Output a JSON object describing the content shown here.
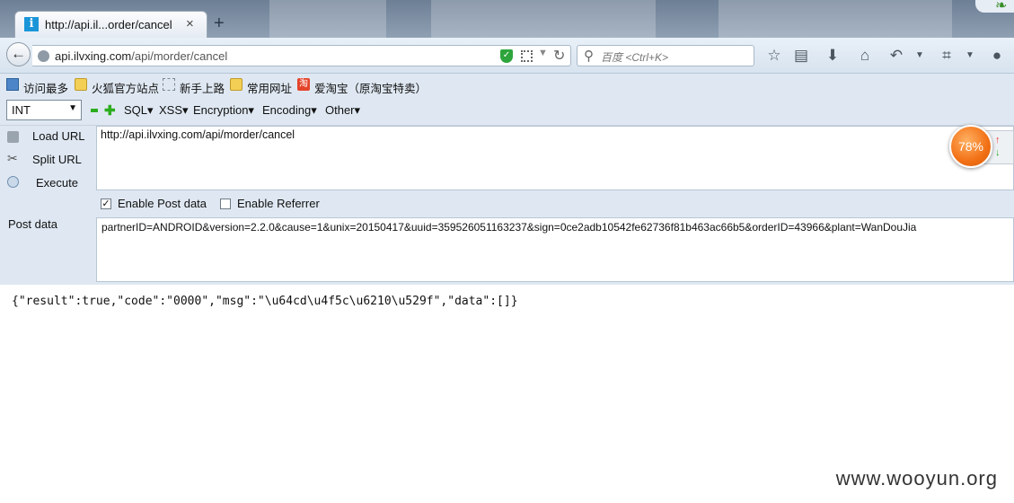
{
  "tab": {
    "title": "http://api.il...order/cancel",
    "close": "×",
    "new_tab": "+"
  },
  "navbar": {
    "url_host": "api.ilvxing.com",
    "url_path": "/api/morder/cancel",
    "search_placeholder": "百度 <Ctrl+K>"
  },
  "bookmarks": [
    {
      "label": "访问最多",
      "icon": "frequent-icon"
    },
    {
      "label": "火狐官方站点",
      "icon": "folder-icon"
    },
    {
      "label": "新手上路",
      "icon": "dashed-folder-icon"
    },
    {
      "label": "常用网址",
      "icon": "folder-icon"
    },
    {
      "label": "爱淘宝（原淘宝特卖）",
      "icon": "taobao-icon",
      "icon_text": "淘"
    }
  ],
  "hackbar": {
    "select_value": "INT",
    "menus": [
      "SQL▾",
      "XSS▾",
      "Encryption▾",
      "Encoding▾",
      "Other▾"
    ],
    "load_url": "Load URL",
    "split_url": "Split URL",
    "execute": "Execute",
    "url_value": "http://api.ilvxing.com/api/morder/cancel",
    "enable_post": "Enable Post data",
    "enable_referrer": "Enable Referrer",
    "post_label": "Post data",
    "post_value": "partnerID=ANDROID&version=2.2.0&cause=1&unix=20150417&uuid=359526051163237&sign=0ce2adb10542fe62736f81b463ac66b5&orderID=43966&plant=WanDouJia"
  },
  "response": "{\"result\":true,\"code\":\"0000\",\"msg\":\"\\u64cd\\u4f5c\\u6210\\u529f\",\"data\":[]}",
  "memory_widget": {
    "percent": "78%"
  },
  "watermark": "www.wooyun.org"
}
